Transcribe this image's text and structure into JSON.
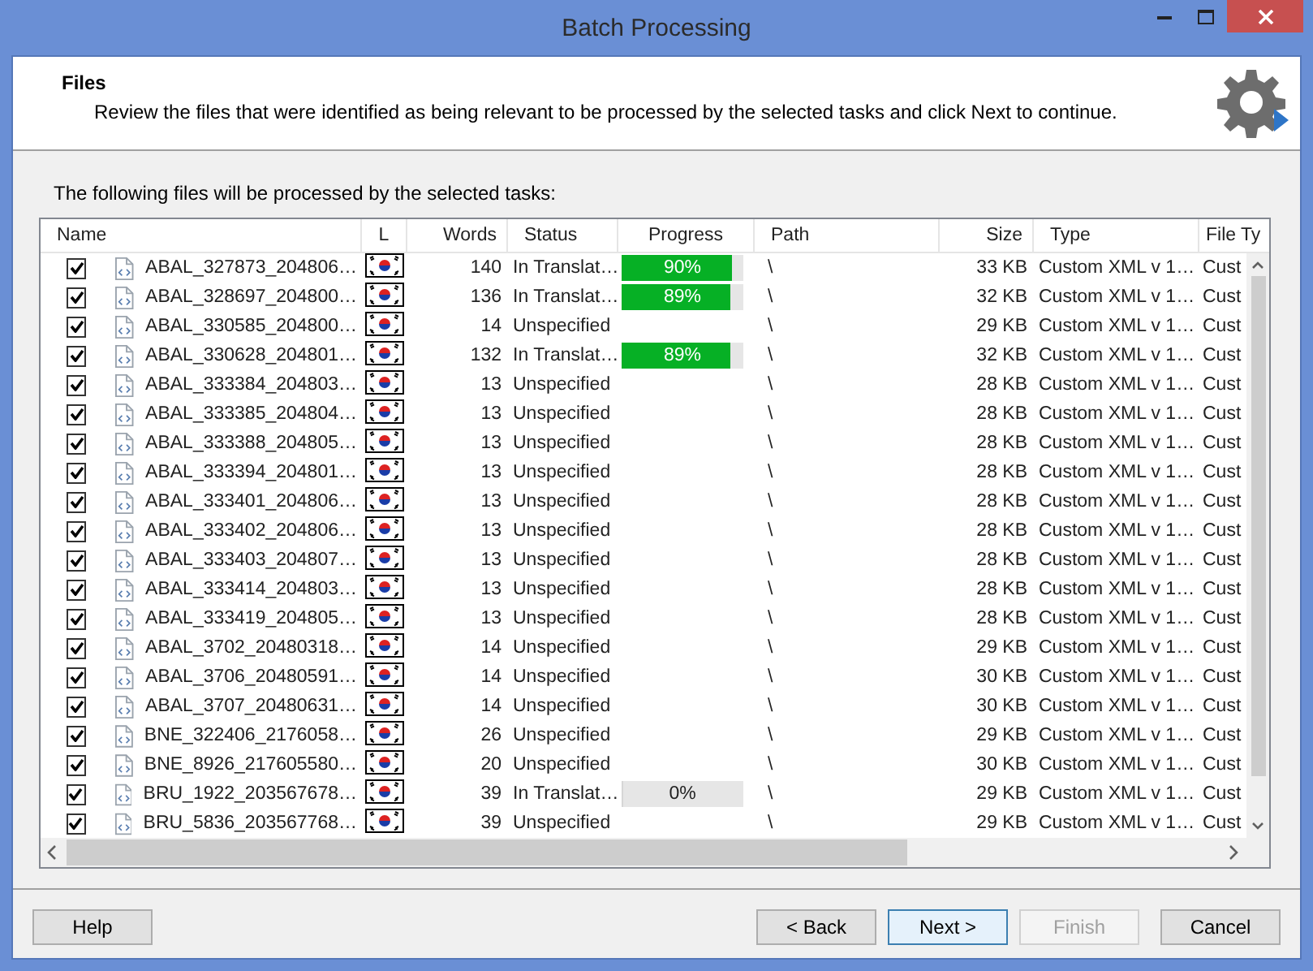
{
  "window": {
    "title": "Batch Processing"
  },
  "header": {
    "title": "Files",
    "description": "Review the files that were identified as being relevant to be processed by the selected tasks and click Next to continue."
  },
  "intro": "The following files will be processed by the selected tasks:",
  "table": {
    "columns": [
      "Name",
      "L",
      "Words",
      "Status",
      "Progress",
      "Path",
      "Size",
      "Type",
      "File Ty"
    ],
    "rows": [
      {
        "checked": true,
        "name": "ABAL_327873_204806…",
        "words": "140",
        "status": "In Translat…",
        "progress": {
          "level": 0.9,
          "text": "90%"
        },
        "path": "\\",
        "size": "33 KB",
        "type": "Custom XML v 1…",
        "file_type": "Cust"
      },
      {
        "checked": true,
        "name": "ABAL_328697_204800…",
        "words": "136",
        "status": "In Translat…",
        "progress": {
          "level": 0.89,
          "text": "89%"
        },
        "path": "\\",
        "size": "32 KB",
        "type": "Custom XML v 1…",
        "file_type": "Cust"
      },
      {
        "checked": true,
        "name": "ABAL_330585_204800…",
        "words": "14",
        "status": "Unspecified",
        "path": "\\",
        "size": "29 KB",
        "type": "Custom XML v 1…",
        "file_type": "Cust"
      },
      {
        "checked": true,
        "name": "ABAL_330628_204801…",
        "words": "132",
        "status": "In Translat…",
        "progress": {
          "level": 0.89,
          "text": "89%"
        },
        "path": "\\",
        "size": "32 KB",
        "type": "Custom XML v 1…",
        "file_type": "Cust"
      },
      {
        "checked": true,
        "name": "ABAL_333384_204803…",
        "words": "13",
        "status": "Unspecified",
        "path": "\\",
        "size": "28 KB",
        "type": "Custom XML v 1…",
        "file_type": "Cust"
      },
      {
        "checked": true,
        "name": "ABAL_333385_204804…",
        "words": "13",
        "status": "Unspecified",
        "path": "\\",
        "size": "28 KB",
        "type": "Custom XML v 1…",
        "file_type": "Cust"
      },
      {
        "checked": true,
        "name": "ABAL_333388_204805…",
        "words": "13",
        "status": "Unspecified",
        "path": "\\",
        "size": "28 KB",
        "type": "Custom XML v 1…",
        "file_type": "Cust"
      },
      {
        "checked": true,
        "name": "ABAL_333394_204801…",
        "words": "13",
        "status": "Unspecified",
        "path": "\\",
        "size": "28 KB",
        "type": "Custom XML v 1…",
        "file_type": "Cust"
      },
      {
        "checked": true,
        "name": "ABAL_333401_204806…",
        "words": "13",
        "status": "Unspecified",
        "path": "\\",
        "size": "28 KB",
        "type": "Custom XML v 1…",
        "file_type": "Cust"
      },
      {
        "checked": true,
        "name": "ABAL_333402_204806…",
        "words": "13",
        "status": "Unspecified",
        "path": "\\",
        "size": "28 KB",
        "type": "Custom XML v 1…",
        "file_type": "Cust"
      },
      {
        "checked": true,
        "name": "ABAL_333403_204807…",
        "words": "13",
        "status": "Unspecified",
        "path": "\\",
        "size": "28 KB",
        "type": "Custom XML v 1…",
        "file_type": "Cust"
      },
      {
        "checked": true,
        "name": "ABAL_333414_204803…",
        "words": "13",
        "status": "Unspecified",
        "path": "\\",
        "size": "28 KB",
        "type": "Custom XML v 1…",
        "file_type": "Cust"
      },
      {
        "checked": true,
        "name": "ABAL_333419_204805…",
        "words": "13",
        "status": "Unspecified",
        "path": "\\",
        "size": "28 KB",
        "type": "Custom XML v 1…",
        "file_type": "Cust"
      },
      {
        "checked": true,
        "name": "ABAL_3702_20480318…",
        "words": "14",
        "status": "Unspecified",
        "path": "\\",
        "size": "29 KB",
        "type": "Custom XML v 1…",
        "file_type": "Cust"
      },
      {
        "checked": true,
        "name": "ABAL_3706_20480591…",
        "words": "14",
        "status": "Unspecified",
        "path": "\\",
        "size": "30 KB",
        "type": "Custom XML v 1…",
        "file_type": "Cust"
      },
      {
        "checked": true,
        "name": "ABAL_3707_20480631…",
        "words": "14",
        "status": "Unspecified",
        "path": "\\",
        "size": "30 KB",
        "type": "Custom XML v 1…",
        "file_type": "Cust"
      },
      {
        "checked": true,
        "name": "BNE_322406_2176058…",
        "words": "26",
        "status": "Unspecified",
        "path": "\\",
        "size": "29 KB",
        "type": "Custom XML v 1…",
        "file_type": "Cust"
      },
      {
        "checked": true,
        "name": "BNE_8926_217605580…",
        "words": "20",
        "status": "Unspecified",
        "path": "\\",
        "size": "30 KB",
        "type": "Custom XML v 1…",
        "file_type": "Cust"
      },
      {
        "checked": true,
        "name": "BRU_1922_203567678…",
        "words": "39",
        "status": "In Translat…",
        "progress": {
          "level": 0,
          "text": "0%"
        },
        "path": "\\",
        "size": "29 KB",
        "type": "Custom XML v 1…",
        "file_type": "Cust"
      },
      {
        "checked": true,
        "name": "BRU_5836_203567768…",
        "words": "39",
        "status": "Unspecified",
        "path": "\\",
        "size": "29 KB",
        "type": "Custom XML v 1…",
        "file_type": "Cust"
      }
    ]
  },
  "buttons": [
    {
      "label": "Help",
      "disabled": false,
      "default": false
    },
    {
      "label": "< Back",
      "disabled": false,
      "default": false
    },
    {
      "label": "Next >",
      "disabled": false,
      "default": true
    },
    {
      "label": "Finish",
      "disabled": true,
      "default": false
    },
    {
      "label": "Cancel",
      "disabled": false,
      "default": false
    }
  ]
}
